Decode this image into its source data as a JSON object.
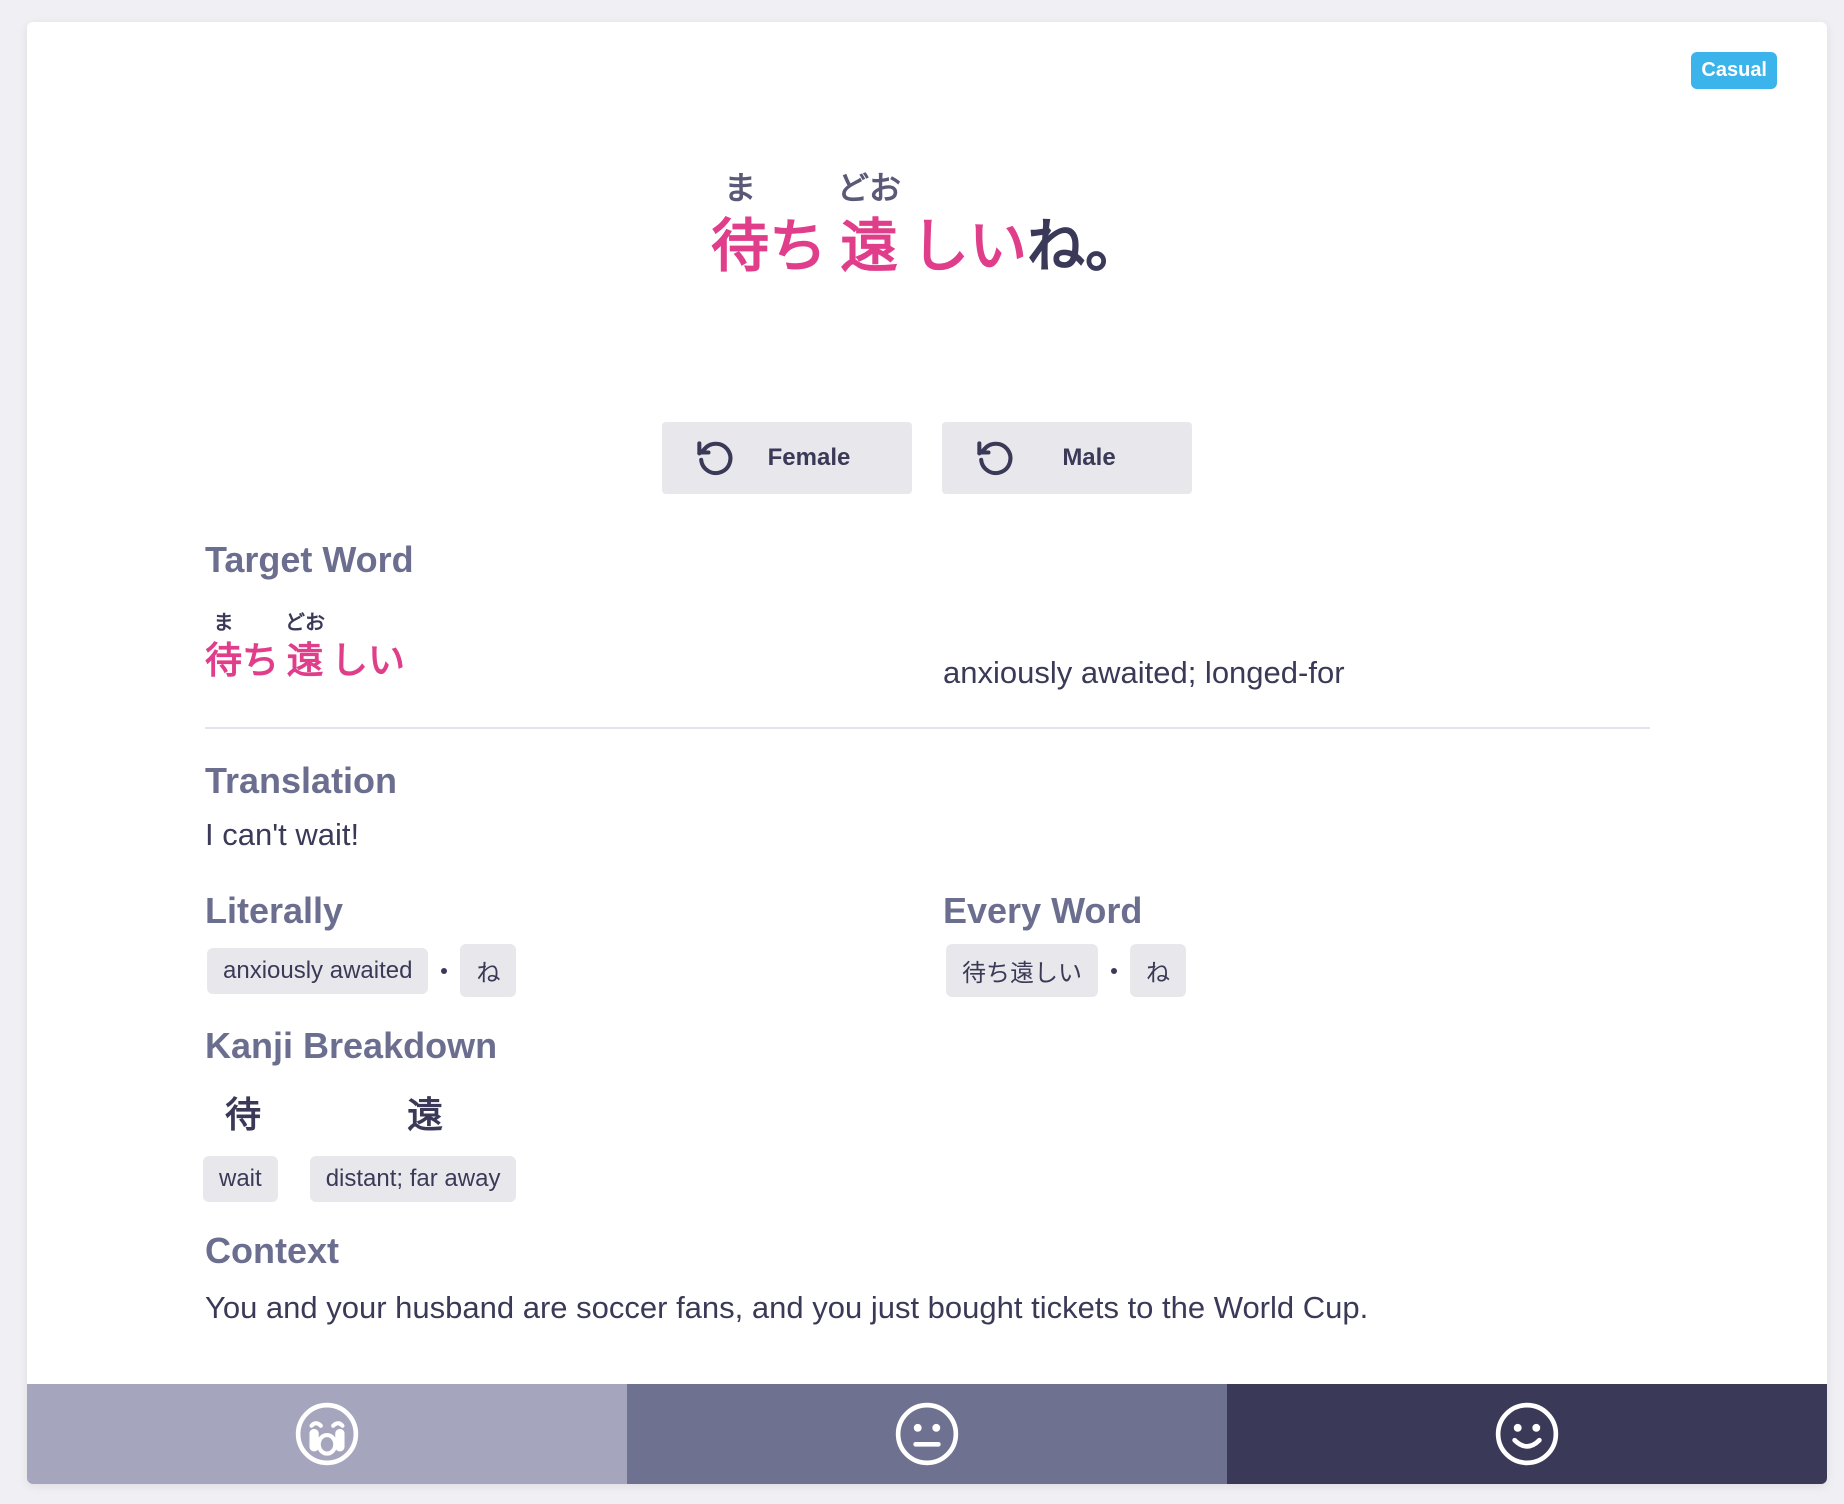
{
  "badge": "Casual",
  "sentence": {
    "parts": [
      {
        "kanji": "待",
        "reading": "ま"
      },
      {
        "text": "ち"
      },
      {
        "kanji": "遠",
        "reading": "どお"
      },
      {
        "text": "しい"
      },
      {
        "text": "ね。"
      }
    ]
  },
  "audio": {
    "female_label": "Female",
    "male_label": "Male"
  },
  "target_word": {
    "title": "Target Word",
    "kanji1": "待",
    "reading1": "ま",
    "kana1": "ち",
    "kanji2": "遠",
    "reading2": "どお",
    "kana2": "しい",
    "meaning": "anxiously awaited; longed-for"
  },
  "translation": {
    "title": "Translation",
    "text": "I can't wait!"
  },
  "literally": {
    "title": "Literally",
    "chips": [
      "anxiously awaited",
      "ね"
    ]
  },
  "every_word": {
    "title": "Every Word",
    "chips": [
      "待ち遠しい",
      "ね"
    ]
  },
  "kanji_breakdown": {
    "title": "Kanji Breakdown",
    "items": [
      {
        "kanji": "待",
        "meaning": "wait"
      },
      {
        "kanji": "遠",
        "meaning": "distant; far away"
      }
    ]
  },
  "context": {
    "title": "Context",
    "text": "You and your husband are soccer fans, and you just bought tickets to the World Cup."
  },
  "footer": {
    "buttons": [
      {
        "name": "hard-button",
        "icon": "crying-face-icon",
        "color": "#a5a6bd"
      },
      {
        "name": "okay-button",
        "icon": "neutral-face-icon",
        "color": "#6e718f"
      },
      {
        "name": "easy-button",
        "icon": "smiling-face-icon",
        "color": "#3a3a58"
      }
    ]
  },
  "colors": {
    "accent": "#e03d8a",
    "badge": "#3bb4ec",
    "text": "#3a3a58",
    "heading": "#6b6e8e"
  }
}
